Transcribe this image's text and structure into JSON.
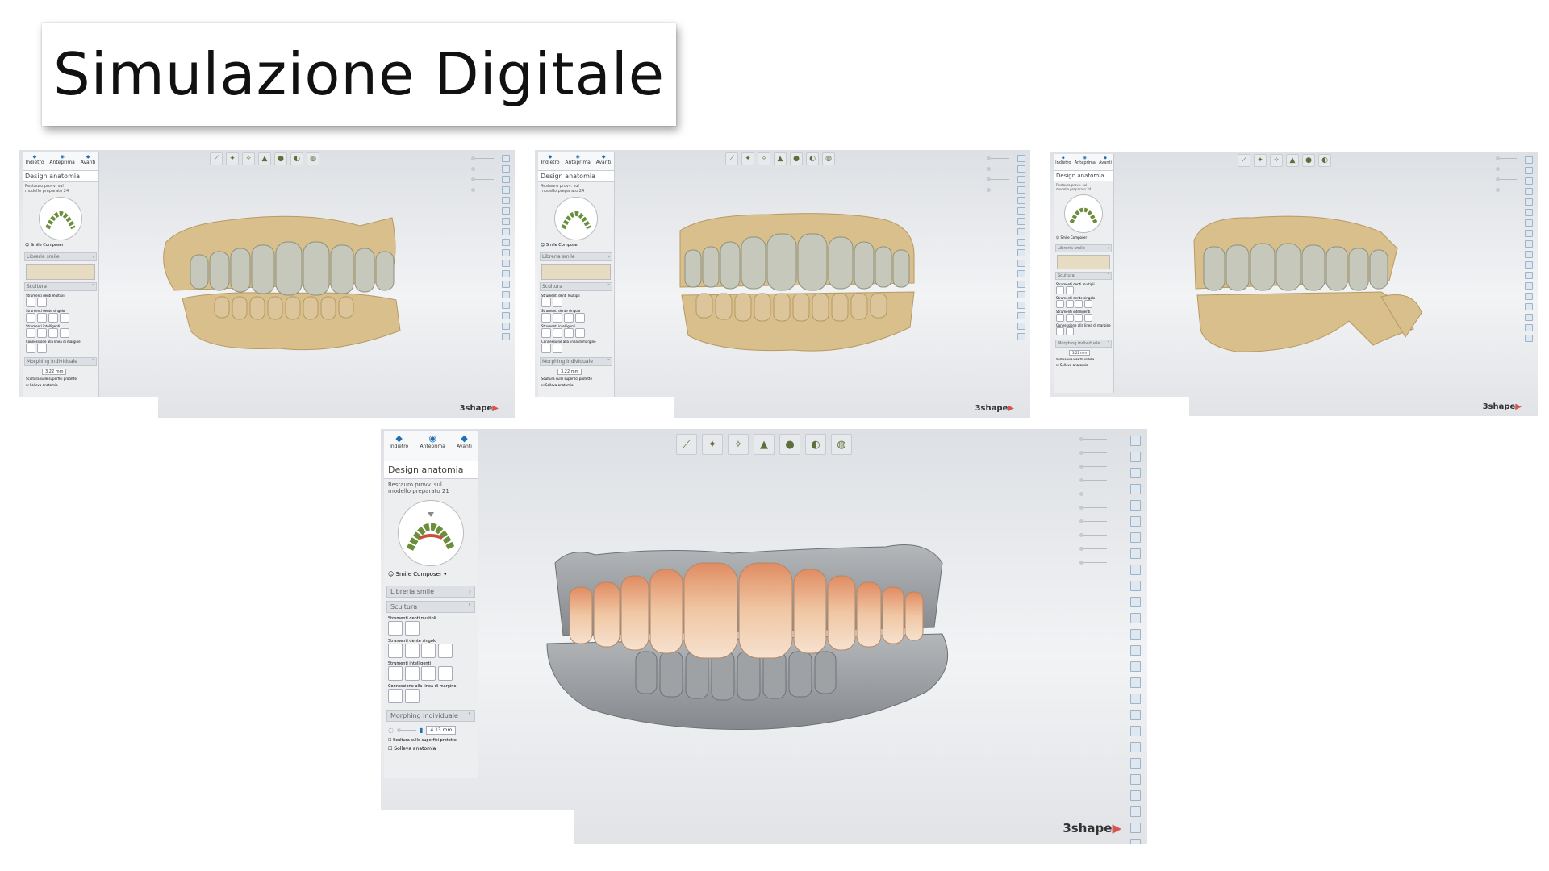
{
  "slide": {
    "title": "Simulazione Digitale"
  },
  "ui": {
    "nav": {
      "back": "Indietro",
      "preview": "Anteprima",
      "next": "Avanti"
    },
    "panel_title": "Design anatomia",
    "restoration": "Restauro provv. sul modello preparato 21",
    "restoration_small": "Restauro provv. sul modello preparato 24",
    "smile_composer": "Smile Composer",
    "smile_library": "Libreria smile",
    "sculpt": "Scultura",
    "multi_tools": "Strumenti denti multipli",
    "single_tools": "Strumenti dente singolo",
    "smart_tools": "Strumenti intelligenti",
    "margin_connection": "Connessione alla linea di margine",
    "morphing": "Morphing individuale",
    "morph_value": "4.13 mm",
    "morph_value_small": "3.22 mm",
    "protected_sculpt": "Scultura sulle superfici protette",
    "lift_anatomy": "Solleva anatomia",
    "brand": "3shape",
    "brand_mark": "▶"
  },
  "colors": {
    "gypsum": "#d8bf8c",
    "gray_model": "#9fa3a6",
    "mockup_teeth": "#c5c7b8",
    "natural_teeth": "#e9c3a2",
    "accent_blue": "#1f6fb2"
  }
}
